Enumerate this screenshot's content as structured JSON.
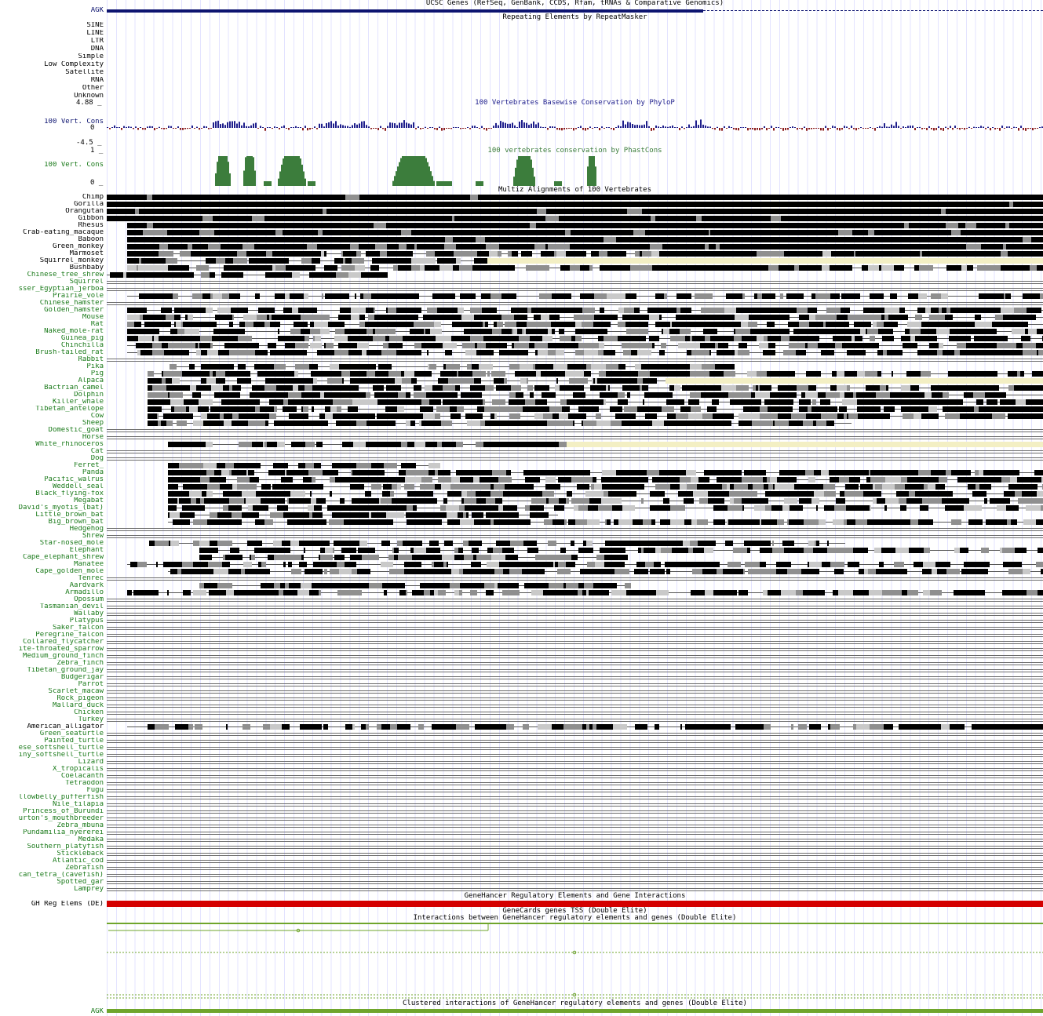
{
  "tracks": {
    "ucsc_genes": {
      "title": "UCSC Genes (RefSeq, GenBank, CCDS, Rfam, tRNAs & Comparative Genomics)",
      "gene_label": "AGK"
    },
    "repeatmasker": {
      "title": "Repeating Elements by RepeatMasker",
      "classes": [
        "SINE",
        "LINE",
        "LTR",
        "DNA",
        "Simple",
        "Low Complexity",
        "Satellite",
        "RNA",
        "Other",
        "Unknown"
      ]
    },
    "phylop": {
      "title": "100 Vertebrates Basewise Conservation by PhyloP",
      "label": "100 Vert. Cons",
      "ymax": "4.88 _",
      "zero": "0",
      "ymin": "-4.5 _",
      "colors": {
        "positive": "#1e1e8c",
        "negative": "#8c1e1e"
      }
    },
    "phastcons": {
      "title": "100 vertebrates conservation by PhastCons",
      "label": "100 Vert. Cons",
      "ymax": "1 _",
      "ymin": "0 _",
      "color": "#3c7d3c"
    },
    "multiz": {
      "title": "Multiz Alignments of 100 Vertebrates",
      "species_black": [
        "Chimp",
        "Gorilla",
        "Orangutan",
        "Gibbon",
        "Rhesus",
        "Crab-eating_macaque",
        "Baboon",
        "Green_monkey",
        "Marmoset",
        "Squirrel_monkey",
        "Bushbaby"
      ],
      "species_rest": [
        {
          "n": "Chinese_tree_shrew",
          "c": "g"
        },
        {
          "n": "Squirrel",
          "c": "g"
        },
        {
          "n": "sser_Egyptian_jerboa",
          "c": "g"
        },
        {
          "n": "Prairie_vole",
          "c": "g"
        },
        {
          "n": "Chinese_hamster",
          "c": "g"
        },
        {
          "n": "Golden_hamster",
          "c": "g"
        },
        {
          "n": "Mouse",
          "c": "g"
        },
        {
          "n": "Rat",
          "c": "g"
        },
        {
          "n": "Naked_mole-rat",
          "c": "g"
        },
        {
          "n": "Guinea_pig",
          "c": "g"
        },
        {
          "n": "Chinchilla",
          "c": "g"
        },
        {
          "n": "Brush-tailed_rat",
          "c": "g"
        },
        {
          "n": "Rabbit",
          "c": "g"
        },
        {
          "n": "Pika",
          "c": "g"
        },
        {
          "n": "Pig",
          "c": "g"
        },
        {
          "n": "Alpaca",
          "c": "g"
        },
        {
          "n": "Bactrian_camel",
          "c": "g"
        },
        {
          "n": "Dolphin",
          "c": "g"
        },
        {
          "n": "Killer_whale",
          "c": "g"
        },
        {
          "n": "Tibetan_antelope",
          "c": "g"
        },
        {
          "n": "Cow",
          "c": "g"
        },
        {
          "n": "Sheep",
          "c": "g"
        },
        {
          "n": "Domestic_goat",
          "c": "g"
        },
        {
          "n": "Horse",
          "c": "g"
        },
        {
          "n": "White_rhinoceros",
          "c": "g"
        },
        {
          "n": "Cat",
          "c": "g"
        },
        {
          "n": "Dog",
          "c": "g"
        },
        {
          "n": "Ferret_",
          "c": "g"
        },
        {
          "n": "Panda",
          "c": "g"
        },
        {
          "n": "Pacific_walrus",
          "c": "g"
        },
        {
          "n": "Weddell_seal",
          "c": "g"
        },
        {
          "n": "Black_flying-fox",
          "c": "g"
        },
        {
          "n": "Megabat",
          "c": "g"
        },
        {
          "n": "David's_myotis_(bat)",
          "c": "g"
        },
        {
          "n": "Little_brown_bat",
          "c": "g"
        },
        {
          "n": "Big_brown_bat",
          "c": "g"
        },
        {
          "n": "Hedgehog",
          "c": "g"
        },
        {
          "n": "Shrew",
          "c": "g"
        },
        {
          "n": "Star-nosed_mole",
          "c": "g"
        },
        {
          "n": "Elephant",
          "c": "g"
        },
        {
          "n": "Cape_elephant_shrew",
          "c": "g"
        },
        {
          "n": "Manatee",
          "c": "g"
        },
        {
          "n": "Cape_golden_mole",
          "c": "g"
        },
        {
          "n": "Tenrec",
          "c": "g"
        },
        {
          "n": "Aardvark",
          "c": "g"
        },
        {
          "n": "Armadillo",
          "c": "g"
        },
        {
          "n": "Opossum",
          "c": "g"
        },
        {
          "n": "Tasmanian_devil",
          "c": "g"
        },
        {
          "n": "Wallaby",
          "c": "g"
        },
        {
          "n": "Platypus",
          "c": "g"
        },
        {
          "n": "Saker_falcon",
          "c": "g"
        },
        {
          "n": "Peregrine_falcon",
          "c": "g"
        },
        {
          "n": "Collared_flycatcher",
          "c": "g"
        },
        {
          "n": "ite-throated_sparrow",
          "c": "g"
        },
        {
          "n": "Medium_ground_finch",
          "c": "g"
        },
        {
          "n": "Zebra_finch",
          "c": "g"
        },
        {
          "n": "Tibetan_ground_jay",
          "c": "g"
        },
        {
          "n": "Budgerigar",
          "c": "g"
        },
        {
          "n": "Parrot",
          "c": "g"
        },
        {
          "n": "Scarlet_macaw",
          "c": "g"
        },
        {
          "n": "Rock_pigeon",
          "c": "g"
        },
        {
          "n": "Mallard_duck",
          "c": "g"
        },
        {
          "n": "Chicken",
          "c": "g"
        },
        {
          "n": "Turkey",
          "c": "g"
        },
        {
          "n": "American_alligator",
          "c": "b"
        },
        {
          "n": "Green_seaturtle",
          "c": "g"
        },
        {
          "n": "Painted_turtle",
          "c": "g"
        },
        {
          "n": "ese_softshell_turtle",
          "c": "g"
        },
        {
          "n": "iny_softshell_turtle",
          "c": "g"
        },
        {
          "n": "Lizard",
          "c": "g"
        },
        {
          "n": "X_tropicalis",
          "c": "g"
        },
        {
          "n": "Coelacanth",
          "c": "g"
        },
        {
          "n": "Tetraodon",
          "c": "g"
        },
        {
          "n": "Fugu",
          "c": "g"
        },
        {
          "n": "llowbelly_pufferfish",
          "c": "g"
        },
        {
          "n": "Nile_tilapia",
          "c": "g"
        },
        {
          "n": "Princess_of_Burundi",
          "c": "g"
        },
        {
          "n": "urton's_mouthbreeder",
          "c": "g"
        },
        {
          "n": "Zebra_mbuna",
          "c": "g"
        },
        {
          "n": "Pundamilia_nyererei",
          "c": "g"
        },
        {
          "n": "Medaka",
          "c": "g"
        },
        {
          "n": "Southern_platyfish",
          "c": "g"
        },
        {
          "n": "Stickleback",
          "c": "g"
        },
        {
          "n": "Atlantic_cod",
          "c": "g"
        },
        {
          "n": "Zebrafish",
          "c": "g"
        },
        {
          "n": "can_tetra_(cavefish)",
          "c": "g"
        },
        {
          "n": "Spotted_gar",
          "c": "g"
        },
        {
          "n": "Lamprey",
          "c": "g"
        }
      ]
    },
    "genehancer": {
      "title": "GeneHancer Regulatory Elements and Gene Interactions",
      "label": "GH Reg Elems (DE)",
      "color": "#d40000"
    },
    "genecards_tss": {
      "title": "GeneCards genes TSS (Double Elite)"
    },
    "gh_interactions": {
      "title": "Interactions between GeneHancer regulatory elements and genes (Double Elite)"
    },
    "gh_clustered": {
      "title": "Clustered interactions of GeneHancer regulatory elements and genes (Double Elite)",
      "gene_label": "AGK"
    }
  }
}
